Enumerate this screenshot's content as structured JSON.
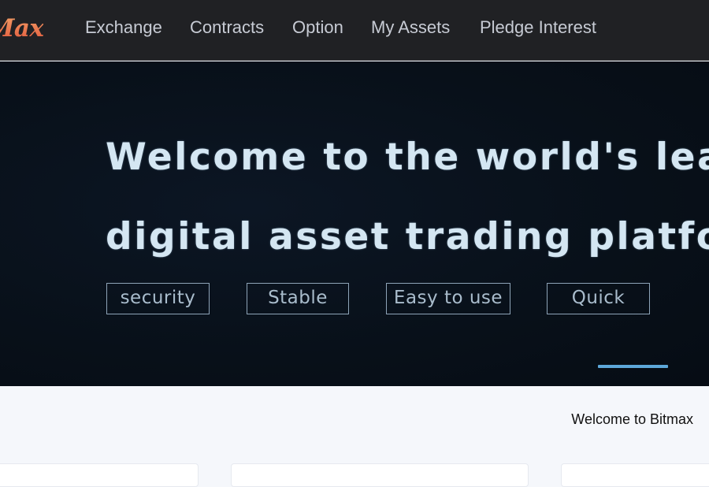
{
  "brand": {
    "logo_text": "Max"
  },
  "nav": {
    "items": [
      {
        "label": "Exchange"
      },
      {
        "label": "Contracts"
      },
      {
        "label": "Option"
      },
      {
        "label": "My Assets"
      },
      {
        "label": "Pledge Interest"
      }
    ]
  },
  "hero": {
    "line1": "Welcome to the world's leac",
    "line2": "digital asset trading platfor",
    "tags": [
      {
        "label": "security"
      },
      {
        "label": "Stable"
      },
      {
        "label": "Easy to use"
      },
      {
        "label": "Quick"
      }
    ]
  },
  "welcome": {
    "text": "Welcome to Bitmax"
  },
  "colors": {
    "nav_bg": "#202124",
    "hero_bg": "#081019",
    "accent": "#5da7d9",
    "logo_gradient_start": "#f3a46a",
    "logo_gradient_end": "#e0543a"
  }
}
